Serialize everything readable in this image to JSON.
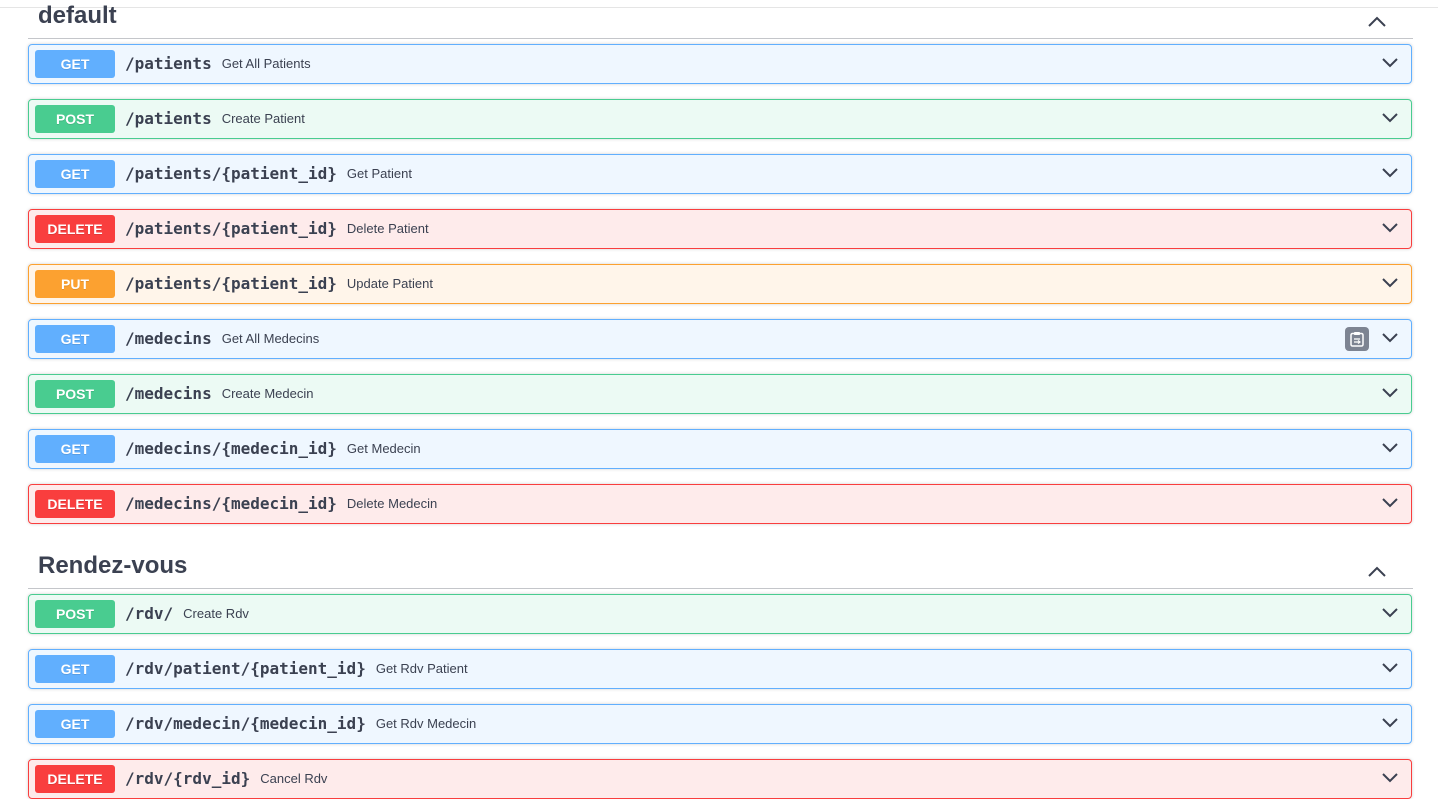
{
  "sections": [
    {
      "title": "default",
      "operations": [
        {
          "method": "GET",
          "path": "/patients",
          "summary": "Get All Patients"
        },
        {
          "method": "POST",
          "path": "/patients",
          "summary": "Create Patient"
        },
        {
          "method": "GET",
          "path": "/patients/{patient_id}",
          "summary": "Get Patient"
        },
        {
          "method": "DELETE",
          "path": "/patients/{patient_id}",
          "summary": "Delete Patient"
        },
        {
          "method": "PUT",
          "path": "/patients/{patient_id}",
          "summary": "Update Patient"
        },
        {
          "method": "GET",
          "path": "/medecins",
          "summary": "Get All Medecins"
        },
        {
          "method": "POST",
          "path": "/medecins",
          "summary": "Create Medecin"
        },
        {
          "method": "GET",
          "path": "/medecins/{medecin_id}",
          "summary": "Get Medecin"
        },
        {
          "method": "DELETE",
          "path": "/medecins/{medecin_id}",
          "summary": "Delete Medecin"
        }
      ]
    },
    {
      "title": "Rendez-vous",
      "operations": [
        {
          "method": "POST",
          "path": "/rdv/",
          "summary": "Create Rdv"
        },
        {
          "method": "GET",
          "path": "/rdv/patient/{patient_id}",
          "summary": "Get Rdv Patient"
        },
        {
          "method": "GET",
          "path": "/rdv/medecin/{medecin_id}",
          "summary": "Get Rdv Medecin"
        },
        {
          "method": "DELETE",
          "path": "/rdv/{rdv_id}",
          "summary": "Cancel Rdv"
        }
      ]
    }
  ],
  "icons": {
    "section_toggle": "chevron-up-icon",
    "operation_toggle": "chevron-down-icon",
    "copy": "clipboard-copy-icon"
  },
  "colors": {
    "get": "#61affe",
    "post": "#49cc90",
    "delete": "#f93e3e",
    "put": "#fca130",
    "copy_button": "#7d8492"
  }
}
